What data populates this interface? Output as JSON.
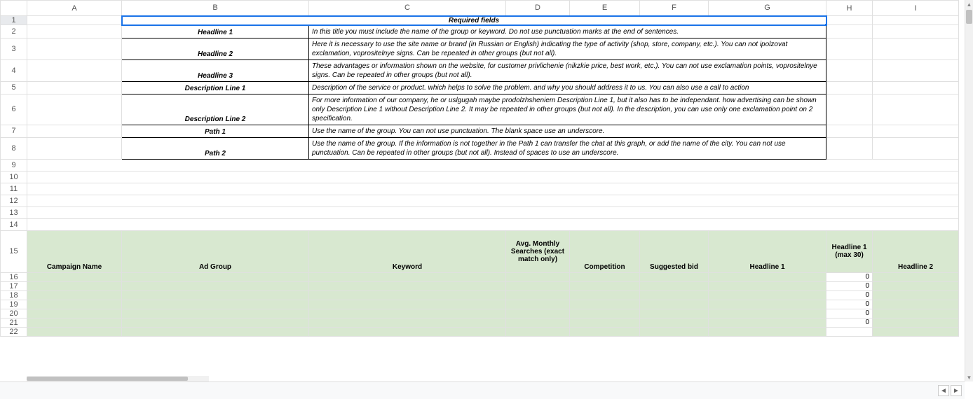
{
  "columns": [
    "A",
    "B",
    "C",
    "D",
    "E",
    "F",
    "G",
    "H",
    "I"
  ],
  "required": {
    "title": "Required fields",
    "rows": [
      {
        "label": "Headline 1",
        "text": "In this title you must include the name of the group or keyword. Do not use punctuation marks at the end of sentences."
      },
      {
        "label": "Headline 2",
        "text": "Here it is necessary to use the site name or brand (in Russian or English) indicating the type of activity (shop, store, company, etc.). You can not ipolzovat exclamation, voprositelnye signs. Can be repeated in other groups (but not all)."
      },
      {
        "label": "Headline 3",
        "text": "These advantages or information shown on the website, for customer privlichenie (nikzkie price, best work, etc.). You can not use exclamation points, voprositelnye signs. Can be repeated in other groups (but not all)."
      },
      {
        "label": "Description Line 1",
        "text": "Description of the service or product. which helps to solve the problem. and why you should address it to us. You can also use a call to action"
      },
      {
        "label": "Description Line 2",
        "text": "For more information of our company, he or uslgugah maybe prodolzhsheniem Description Line 1, but it also has to be independant. how advertising can be shown only Description Line 1 without Description Line 2. It may be repeated in other groups (but not all). In the description, you can use only one exclamation point on 2 specification."
      },
      {
        "label": "Path 1",
        "text": "Use the name of the group. You can not use punctuation. The blank space use an underscore."
      },
      {
        "label": "Path 2",
        "text": "Use the name of the group. If the information is not together in the Path 1 can transfer the chat at this graph, or add the name of the city. You can not use punctuation. Can be repeated in other groups (but not all). Instead of spaces to use an underscore."
      }
    ]
  },
  "tableHeaders": {
    "A": "Campaign Name",
    "B": "Ad Group",
    "C": "Keyword",
    "D": "Avg. Monthly Searches (exact match only)",
    "E": "Competition",
    "F": "Suggested bid",
    "G": "Headline 1",
    "H": "Headline 1 (max 30)",
    "I": "Headline 2"
  },
  "dataRows": [
    "16",
    "17",
    "18",
    "19",
    "20",
    "21",
    "22"
  ],
  "zeroVal": "0",
  "nav": {
    "left": "◄",
    "right": "►"
  }
}
